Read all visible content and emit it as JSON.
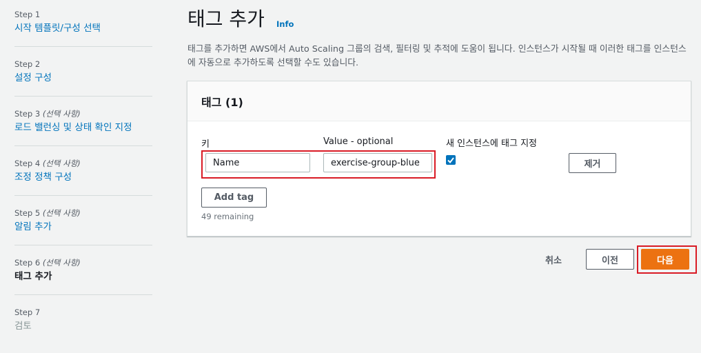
{
  "sidebar": {
    "steps": [
      {
        "num": "Step 1",
        "optional": "",
        "title": "시작 템플릿/구성 선택"
      },
      {
        "num": "Step 2",
        "optional": "",
        "title": "설정 구성"
      },
      {
        "num": "Step 3",
        "optional": "(선택 사항)",
        "title": "로드 밸런싱 및 상태 확인 지정"
      },
      {
        "num": "Step 4",
        "optional": "(선택 사항)",
        "title": "조정 정책 구성"
      },
      {
        "num": "Step 5",
        "optional": "(선택 사항)",
        "title": "알림 추가"
      },
      {
        "num": "Step 6",
        "optional": "(선택 사항)",
        "title": "태그 추가"
      },
      {
        "num": "Step 7",
        "optional": "",
        "title": "검토"
      }
    ]
  },
  "main": {
    "title": "태그 추가",
    "info": "Info",
    "description": "태그를 추가하면 AWS에서 Auto Scaling 그룹의 검색, 필터링 및 추적에 도움이 됩니다. 인스턴스가 시작될 때 이러한 태그를 인스턴스에 자동으로 추가하도록 선택할 수도 있습니다."
  },
  "tags_panel": {
    "title": "태그 (1)",
    "key_label": "키",
    "value_label": "Value - optional",
    "propagate_label": "새 인스턴스에 태그 지정",
    "key_value": "Name",
    "value_value": "exercise-group-blue",
    "propagate_checked": true,
    "remove_label": "제거",
    "add_tag_label": "Add tag",
    "remaining": "49 remaining"
  },
  "footer": {
    "cancel_label": "취소",
    "previous_label": "이전",
    "next_label": "다음"
  },
  "colors": {
    "link": "#0073bb",
    "primary": "#ec7211",
    "highlight": "#d91a24"
  }
}
